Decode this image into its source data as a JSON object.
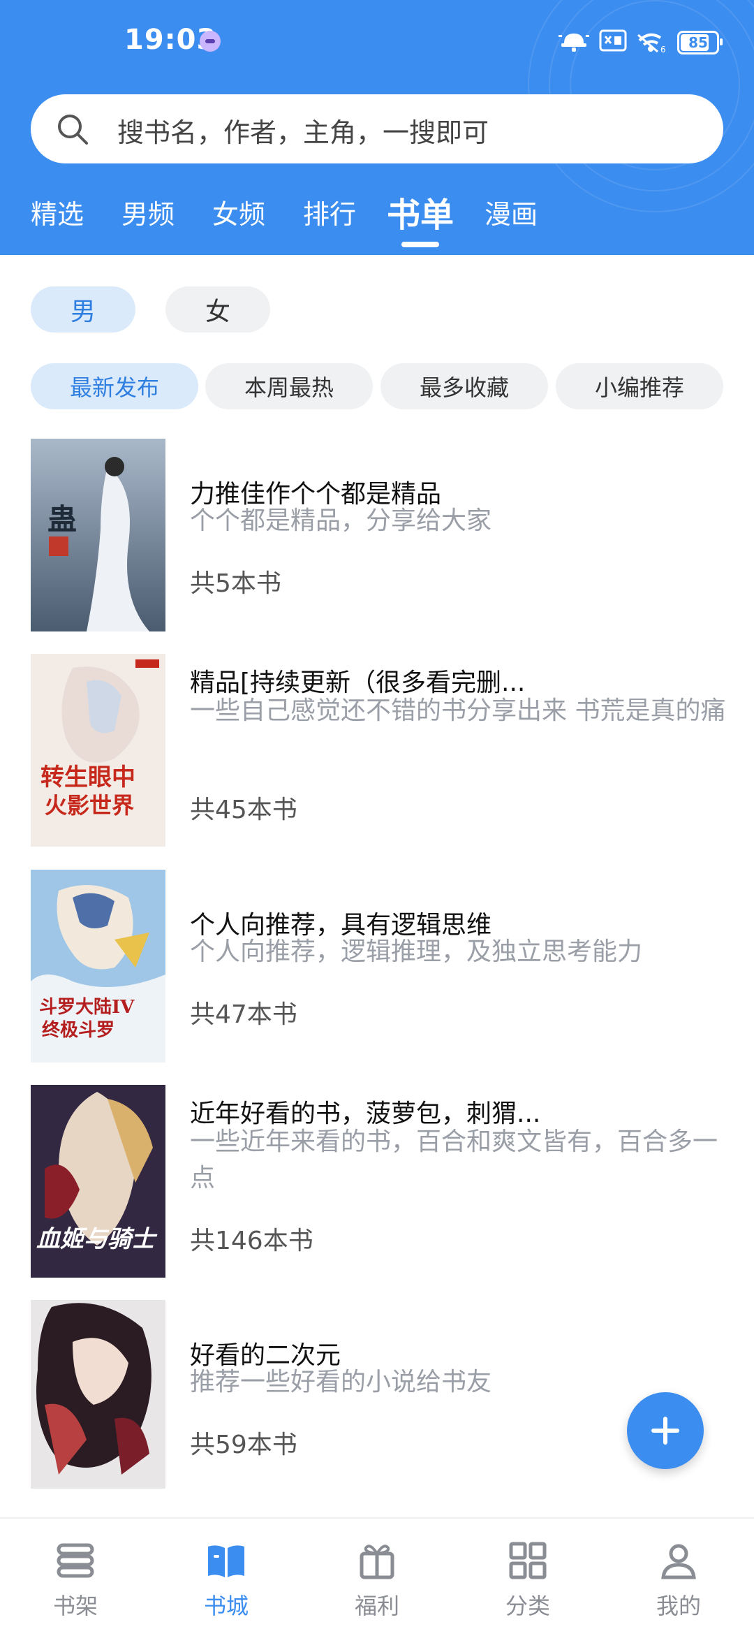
{
  "status_bar": {
    "time": "19:03",
    "battery": "85"
  },
  "search": {
    "placeholder": "搜书名，作者，主角，一搜即可"
  },
  "tabs": [
    {
      "label": "精选"
    },
    {
      "label": "男频"
    },
    {
      "label": "女频"
    },
    {
      "label": "排行"
    },
    {
      "label": "书单",
      "active": true
    },
    {
      "label": "漫画"
    }
  ],
  "gender": {
    "male": "男",
    "female": "女",
    "selected": "男"
  },
  "sort_chips": [
    {
      "label": "最新发布",
      "active": true
    },
    {
      "label": "本周最热"
    },
    {
      "label": "最多收藏"
    },
    {
      "label": "小编推荐"
    }
  ],
  "booklists": [
    {
      "title": "力推佳作个个都是精品",
      "desc": "个个都是精品，分享给大家",
      "count": "共5本书"
    },
    {
      "title": "精品[持续更新（很多看完删...",
      "desc": "一些自己感觉还不错的书分享出来 书荒是真的痛",
      "count": "共45本书"
    },
    {
      "title": "个人向推荐，具有逻辑思维",
      "desc": "个人向推荐，逻辑推理，及独立思考能力",
      "count": "共47本书"
    },
    {
      "title": "近年好看的书，菠萝包，刺猬...",
      "desc": "一些近年来看的书，百合和爽文皆有，百合多一点",
      "count": "共146本书"
    },
    {
      "title": "好看的二次元",
      "desc": "推荐一些好看的小说给书友",
      "count": "共59本书"
    }
  ],
  "covers": [
    {
      "text": "蛊 真 人",
      "colors": [
        "#7a8fa8",
        "#dfe6ee",
        "#3c4a5e"
      ]
    },
    {
      "text": "转生眼中火影世界",
      "colors": [
        "#f4eee8",
        "#e8d6d0",
        "#c73528"
      ]
    },
    {
      "text": "斗罗大陆IV终极斗罗",
      "colors": [
        "#9fc6e6",
        "#f1ece4",
        "#c22a2a"
      ]
    },
    {
      "text": "血姬与骑士",
      "colors": [
        "#3a2d4a",
        "#d9b06c",
        "#4a7fd0"
      ]
    },
    {
      "text": "",
      "colors": [
        "#2a1c22",
        "#b84040",
        "#dcdcdc"
      ]
    }
  ],
  "bottom_nav": [
    {
      "label": "书架",
      "icon": "bookshelf-icon"
    },
    {
      "label": "书城",
      "icon": "book-open-icon",
      "active": true
    },
    {
      "label": "福利",
      "icon": "gift-icon"
    },
    {
      "label": "分类",
      "icon": "grid-icon"
    },
    {
      "label": "我的",
      "icon": "user-icon"
    }
  ],
  "colors": {
    "brand": "#3c8df0",
    "chip_active_bg": "#dbeafb",
    "chip_bg": "#f0f1f3"
  }
}
